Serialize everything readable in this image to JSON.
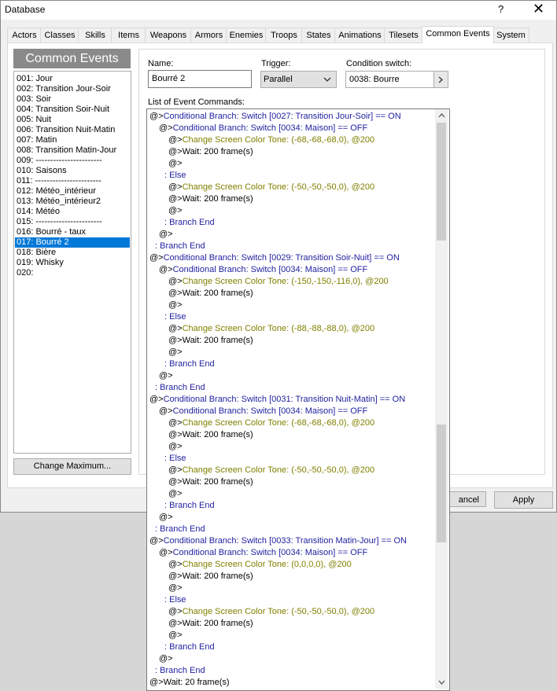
{
  "window": {
    "title": "Database",
    "help": "?",
    "close": "✕"
  },
  "tabs": [
    "Actors",
    "Classes",
    "Skills",
    "Items",
    "Weapons",
    "Armors",
    "Enemies",
    "Troops",
    "States",
    "Animations",
    "Tilesets",
    "Common Events",
    "System"
  ],
  "active_tab": "Common Events",
  "sidebar": {
    "header": "Common Events",
    "items": [
      "001: Jour",
      "002: Transition Jour-Soir",
      "003: Soir",
      "004: Transition Soir-Nuit",
      "005: Nuit",
      "006: Transition Nuit-Matin",
      "007: Matin",
      "008: Transition Matin-Jour",
      "009: -----------------------",
      "010: Saisons",
      "011: -----------------------",
      "012: Météo_intérieur",
      "013: Météo_intérieur2",
      "014: Météo",
      "015: -----------------------",
      "016: Bourré - taux",
      "017: Bourré 2",
      "018: Bière",
      "019: Whisky",
      "020:"
    ],
    "selected_index": 16,
    "change_max": "Change Maximum..."
  },
  "form": {
    "name_label": "Name:",
    "name_value": "Bourré 2",
    "trigger_label": "Trigger:",
    "trigger_value": "Parallel",
    "switch_label": "Condition switch:",
    "switch_value": "0038: Bourre",
    "list_label": "List of Event Commands:"
  },
  "buttons": {
    "cancel": "ancel",
    "apply": "Apply"
  },
  "commands": [
    {
      "text": "@>Conditional Branch: Switch [0027: Transition Jour-Soir] == ON",
      "indent": 0,
      "kind": "ctrl"
    },
    {
      "text": "@>Conditional Branch: Switch [0034: Maison] == OFF",
      "indent": 1,
      "kind": "ctrl"
    },
    {
      "text": "@>Change Screen Color Tone: (-68,-68,-68,0), @200",
      "indent": 2,
      "kind": "screen"
    },
    {
      "text": "@>Wait: 200 frame(s)",
      "indent": 2,
      "kind": "plain"
    },
    {
      "text": "@>",
      "indent": 2,
      "kind": "plain"
    },
    {
      "text": ":  Else",
      "indent": 1.6,
      "kind": "ctrl"
    },
    {
      "text": "@>Change Screen Color Tone: (-50,-50,-50,0), @200",
      "indent": 2,
      "kind": "screen"
    },
    {
      "text": "@>Wait: 200 frame(s)",
      "indent": 2,
      "kind": "plain"
    },
    {
      "text": "@>",
      "indent": 2,
      "kind": "plain"
    },
    {
      "text": ":  Branch End",
      "indent": 1.6,
      "kind": "ctrl"
    },
    {
      "text": "@>",
      "indent": 1,
      "kind": "plain"
    },
    {
      "text": ":  Branch End",
      "indent": 0.6,
      "kind": "ctrl"
    },
    {
      "text": "@>Conditional Branch: Switch [0029: Transition Soir-Nuit] == ON",
      "indent": 0,
      "kind": "ctrl"
    },
    {
      "text": "@>Conditional Branch: Switch [0034: Maison] == OFF",
      "indent": 1,
      "kind": "ctrl"
    },
    {
      "text": "@>Change Screen Color Tone: (-150,-150,-116,0), @200",
      "indent": 2,
      "kind": "screen"
    },
    {
      "text": "@>Wait: 200 frame(s)",
      "indent": 2,
      "kind": "plain"
    },
    {
      "text": "@>",
      "indent": 2,
      "kind": "plain"
    },
    {
      "text": ":  Else",
      "indent": 1.6,
      "kind": "ctrl"
    },
    {
      "text": "@>Change Screen Color Tone: (-88,-88,-88,0), @200",
      "indent": 2,
      "kind": "screen"
    },
    {
      "text": "@>Wait: 200 frame(s)",
      "indent": 2,
      "kind": "plain"
    },
    {
      "text": "@>",
      "indent": 2,
      "kind": "plain"
    },
    {
      "text": ":  Branch End",
      "indent": 1.6,
      "kind": "ctrl"
    },
    {
      "text": "@>",
      "indent": 1,
      "kind": "plain"
    },
    {
      "text": ":  Branch End",
      "indent": 0.6,
      "kind": "ctrl"
    },
    {
      "text": "@>Conditional Branch: Switch [0031: Transition Nuit-Matin] == ON",
      "indent": 0,
      "kind": "ctrl"
    },
    {
      "text": "@>Conditional Branch: Switch [0034: Maison] == OFF",
      "indent": 1,
      "kind": "ctrl"
    },
    {
      "text": "@>Change Screen Color Tone: (-68,-68,-68,0), @200",
      "indent": 2,
      "kind": "screen"
    },
    {
      "text": "@>Wait: 200 frame(s)",
      "indent": 2,
      "kind": "plain"
    },
    {
      "text": "@>",
      "indent": 2,
      "kind": "plain"
    },
    {
      "text": ":  Else",
      "indent": 1.6,
      "kind": "ctrl"
    },
    {
      "text": "@>Change Screen Color Tone: (-50,-50,-50,0), @200",
      "indent": 2,
      "kind": "screen"
    },
    {
      "text": "@>Wait: 200 frame(s)",
      "indent": 2,
      "kind": "plain"
    },
    {
      "text": "@>",
      "indent": 2,
      "kind": "plain"
    },
    {
      "text": ":  Branch End",
      "indent": 1.6,
      "kind": "ctrl"
    },
    {
      "text": "@>",
      "indent": 1,
      "kind": "plain"
    },
    {
      "text": ":  Branch End",
      "indent": 0.6,
      "kind": "ctrl"
    },
    {
      "text": "@>Conditional Branch: Switch [0033: Transition Matin-Jour] == ON",
      "indent": 0,
      "kind": "ctrl"
    },
    {
      "text": "@>Conditional Branch: Switch [0034: Maison] == OFF",
      "indent": 1,
      "kind": "ctrl"
    },
    {
      "text": "@>Change Screen Color Tone: (0,0,0,0), @200",
      "indent": 2,
      "kind": "screen"
    },
    {
      "text": "@>Wait: 200 frame(s)",
      "indent": 2,
      "kind": "plain"
    },
    {
      "text": "@>",
      "indent": 2,
      "kind": "plain"
    },
    {
      "text": ":  Else",
      "indent": 1.6,
      "kind": "ctrl"
    },
    {
      "text": "@>Change Screen Color Tone: (-50,-50,-50,0), @200",
      "indent": 2,
      "kind": "screen"
    },
    {
      "text": "@>Wait: 200 frame(s)",
      "indent": 2,
      "kind": "plain"
    },
    {
      "text": "@>",
      "indent": 2,
      "kind": "plain"
    },
    {
      "text": ":  Branch End",
      "indent": 1.6,
      "kind": "ctrl"
    },
    {
      "text": "@>",
      "indent": 1,
      "kind": "plain"
    },
    {
      "text": ":  Branch End",
      "indent": 0.6,
      "kind": "ctrl"
    },
    {
      "text": "@>Wait: 20 frame(s)",
      "indent": 0,
      "kind": "plain"
    }
  ],
  "colors": {
    "selection": "#0078d7",
    "ctrl_text": "#1e1ea0",
    "screen_text": "#808000",
    "header_bg": "#8a8a8a"
  }
}
